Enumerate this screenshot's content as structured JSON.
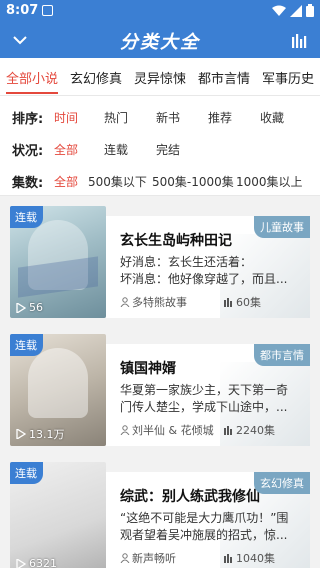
{
  "status": {
    "time": "8:07"
  },
  "header": {
    "title": "分类大全"
  },
  "tabs": [
    "全部小说",
    "玄幻修真",
    "灵异惊悚",
    "都市言情",
    "军事历史"
  ],
  "filters": {
    "sort": {
      "label": "排序:",
      "options": [
        "时间",
        "热门",
        "新书",
        "推荐",
        "收藏"
      ]
    },
    "status": {
      "label": "状况:",
      "options": [
        "全部",
        "连载",
        "完结"
      ]
    },
    "episodes": {
      "label": "集数:",
      "options": [
        "全部",
        "500集以下",
        "500集-1000集",
        "1000集以上"
      ]
    }
  },
  "books": [
    {
      "badge": "连载",
      "title": "玄长生岛屿种田记",
      "category": "儿童故事",
      "desc1": "好消息：玄长生还活着：",
      "desc2": "坏消息：他好像穿越了，而且...",
      "author": "多特熊故事",
      "episodes": "60集",
      "views": "56"
    },
    {
      "badge": "连载",
      "title": "镇国神婿",
      "category": "都市言情",
      "desc1": "华夏第一家族少主，天下第一奇",
      "desc2": "门传人楚尘，学成下山途中，...",
      "author": "刘半仙 & 花倾城",
      "episodes": "2240集",
      "views": "13.1万"
    },
    {
      "badge": "连载",
      "title": "综武：别人练武我修仙",
      "category": "玄幻修真",
      "desc1": "“这绝不可能是大力鹰爪功！”围",
      "desc2": "观者望着吴冲施展的招式，惊...",
      "author": "新声畅听",
      "episodes": "1040集",
      "views": "6321"
    }
  ]
}
